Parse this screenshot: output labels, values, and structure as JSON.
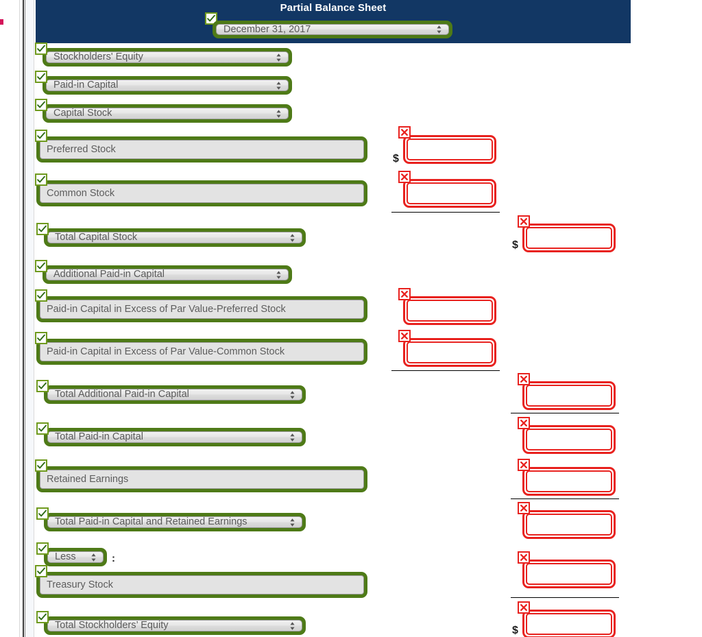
{
  "document": {
    "title": "Partial Balance Sheet",
    "date_select": "December 31, 2017"
  },
  "colors": {
    "banner": "#123764",
    "valid_green": "#4e7a17",
    "error_red": "#e8221f",
    "control_gray": "#e3e3e3"
  },
  "icons": {
    "check": "check-icon",
    "error": "x-icon",
    "spinner": "updown-spinner-icon"
  },
  "labels": {
    "currency_symbol": "$",
    "colon": ":"
  },
  "rows": [
    {
      "label": "Stockholders' Equity",
      "type": "select"
    },
    {
      "label": "Paid-in Capital",
      "type": "select"
    },
    {
      "label": "Capital Stock",
      "type": "select"
    },
    {
      "label": "Preferred Stock",
      "type": "text"
    },
    {
      "label": "Common Stock",
      "type": "text"
    },
    {
      "label": "Total Capital Stock",
      "type": "select"
    },
    {
      "label": "Additional Paid-in Capital",
      "type": "select"
    },
    {
      "label": "Paid-in Capital in Excess of Par Value-Preferred Stock",
      "type": "text"
    },
    {
      "label": "Paid-in Capital in Excess of Par Value-Common Stock",
      "type": "text"
    },
    {
      "label": "Total Additional Paid-in Capital",
      "type": "select"
    },
    {
      "label": "Total Paid-in Capital",
      "type": "select"
    },
    {
      "label": "Retained Earnings",
      "type": "text"
    },
    {
      "label": "Total Paid-in Capital and Retained Earnings",
      "type": "select"
    },
    {
      "label": "Less",
      "type": "select"
    },
    {
      "label": "Treasury Stock",
      "type": "text"
    },
    {
      "label": "Total Stockholders’ Equity",
      "type": "select"
    }
  ],
  "amount_inputs": {
    "column_one": [
      {
        "for": "Preferred Stock",
        "value": "",
        "currency": "$"
      },
      {
        "for": "Common Stock",
        "value": "",
        "currency": ""
      },
      {
        "for": "Paid-in Capital in Excess of Par Value-Preferred Stock",
        "value": "",
        "currency": ""
      },
      {
        "for": "Paid-in Capital in Excess of Par Value-Common Stock",
        "value": "",
        "currency": ""
      }
    ],
    "column_two": [
      {
        "for": "Total Capital Stock",
        "value": "",
        "currency": "$"
      },
      {
        "for": "Total Additional Paid-in Capital",
        "value": "",
        "currency": ""
      },
      {
        "for": "Total Paid-in Capital",
        "value": "",
        "currency": ""
      },
      {
        "for": "Retained Earnings",
        "value": "",
        "currency": ""
      },
      {
        "for": "Total Paid-in Capital and Retained Earnings",
        "value": "",
        "currency": ""
      },
      {
        "for": "Treasury Stock",
        "value": "",
        "currency": ""
      },
      {
        "for": "Total Stockholders’ Equity",
        "value": "",
        "currency": "$"
      }
    ]
  }
}
